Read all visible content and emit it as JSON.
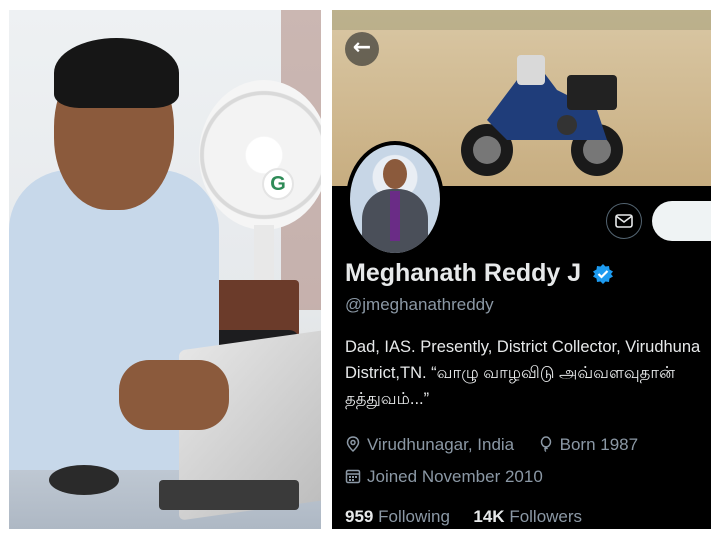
{
  "profile": {
    "name": "Meghanath Reddy J",
    "handle": "@jmeghanathreddy",
    "bio_line1": "Dad, IAS. Presently, District Collector, Virudhuna",
    "bio_line2": "District,TN. “வாழு வாழவிடு அவ்வளவுதான்",
    "bio_line3": "தத்துவம்...”",
    "location": "Virudhunagar, India",
    "born": "Born 1987",
    "joined": "Joined November 2010",
    "following_count": "959",
    "following_label": "Following",
    "followers_count": "14K",
    "followers_label": "Followers"
  },
  "colors": {
    "background": "#000000",
    "primary_text": "#e7e9ea",
    "secondary_text": "#8b98a5",
    "verified": "#1d9bf0"
  },
  "icons": {
    "back": "back-arrow-icon",
    "verified": "verified-badge-icon",
    "location": "location-pin-icon",
    "born": "balloon-icon",
    "joined": "calendar-icon",
    "message": "envelope-icon",
    "fan_logo": "G"
  }
}
